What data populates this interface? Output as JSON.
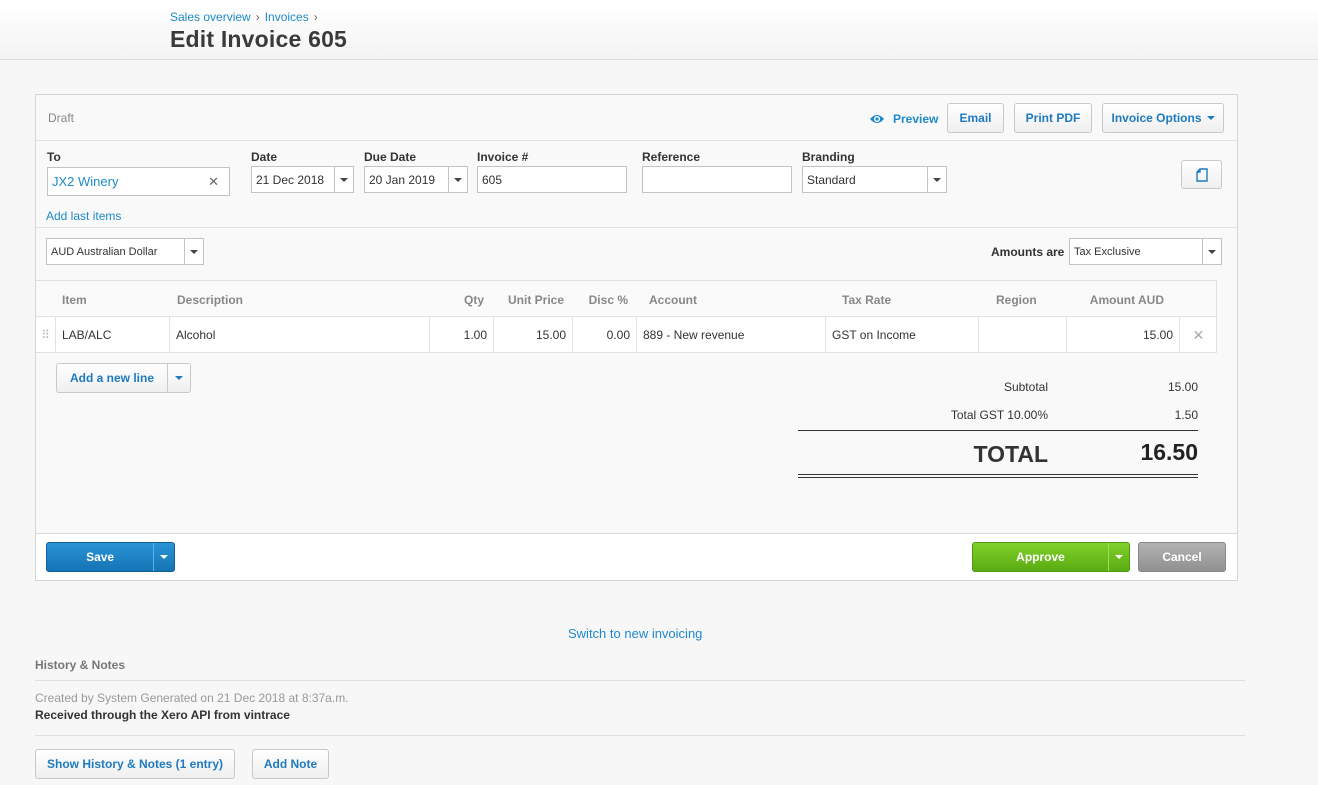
{
  "breadcrumb": {
    "item1": "Sales overview",
    "item2": "Invoices",
    "sep": "›"
  },
  "page_title": "Edit Invoice 605",
  "panel": {
    "status": "Draft",
    "preview": "Preview",
    "email": "Email",
    "print_pdf": "Print PDF",
    "invoice_options": "Invoice Options"
  },
  "form": {
    "to_label": "To",
    "to_value": "JX2 Winery",
    "date_label": "Date",
    "date_value": "21 Dec 2018",
    "due_label": "Due Date",
    "due_value": "20 Jan 2019",
    "invoice_no_label": "Invoice #",
    "invoice_no_value": "605",
    "reference_label": "Reference",
    "reference_value": "",
    "branding_label": "Branding",
    "branding_value": "Standard",
    "add_last_items": "Add last items",
    "currency": "AUD Australian Dollar",
    "amounts_are_label": "Amounts are",
    "amounts_are_value": "Tax Exclusive"
  },
  "table": {
    "headers": {
      "item": "Item",
      "description": "Description",
      "qty": "Qty",
      "unit_price": "Unit Price",
      "disc": "Disc %",
      "account": "Account",
      "tax_rate": "Tax Rate",
      "region": "Region",
      "amount": "Amount AUD"
    },
    "rows": [
      {
        "item": "LAB/ALC",
        "description": "Alcohol",
        "qty": "1.00",
        "unit_price": "15.00",
        "disc": "0.00",
        "account": "889 - New revenue",
        "tax_rate": "GST on Income",
        "region": "",
        "amount": "15.00"
      }
    ]
  },
  "add_line": "Add a new line",
  "totals": {
    "subtotal_label": "Subtotal",
    "subtotal": "15.00",
    "gst_label": "Total GST 10.00%",
    "gst": "1.50",
    "total_label": "TOTAL",
    "total": "16.50"
  },
  "actions": {
    "save": "Save",
    "approve": "Approve",
    "cancel": "Cancel"
  },
  "switch_link": "Switch to new invoicing",
  "history": {
    "title": "History & Notes",
    "created": "Created by System Generated on 21 Dec 2018 at 8:37a.m.",
    "note": "Received through the Xero API from vintrace",
    "show_button": "Show History & Notes (1 entry)",
    "add_note_button": "Add Note"
  },
  "colors": {
    "link": "#1e8ac9",
    "save": "#1a7fc1",
    "approve": "#6cbf1a",
    "cancel": "#9e9e9e"
  }
}
